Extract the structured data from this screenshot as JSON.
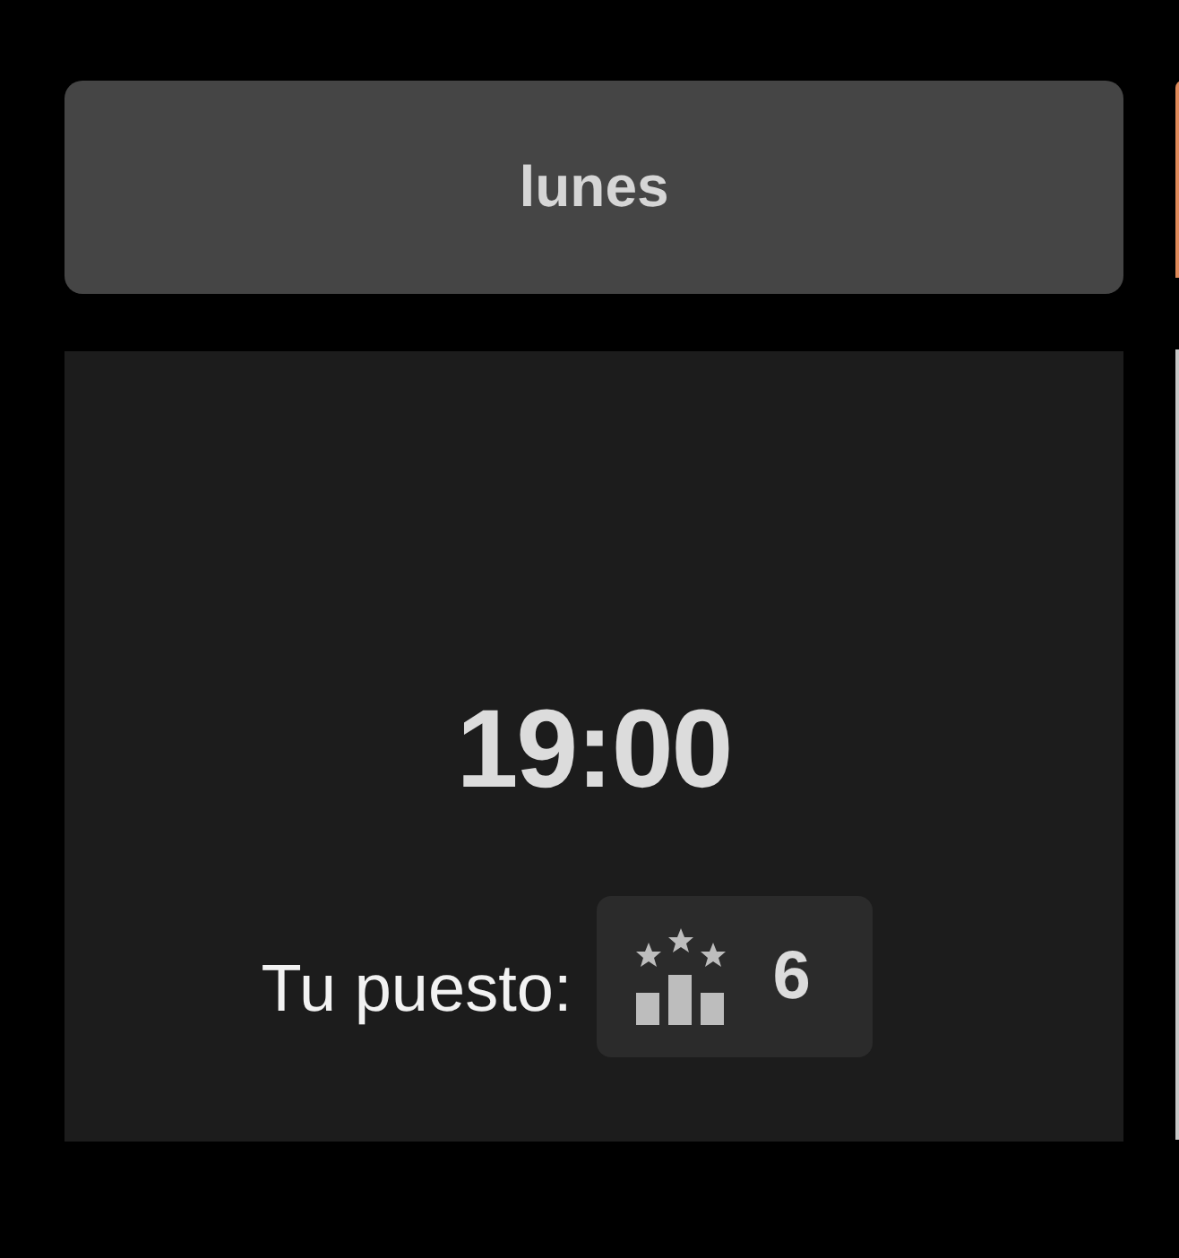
{
  "day": {
    "label": "lunes"
  },
  "slot": {
    "time": "19:00",
    "rank_label": "Tu puesto:",
    "rank": "6"
  }
}
